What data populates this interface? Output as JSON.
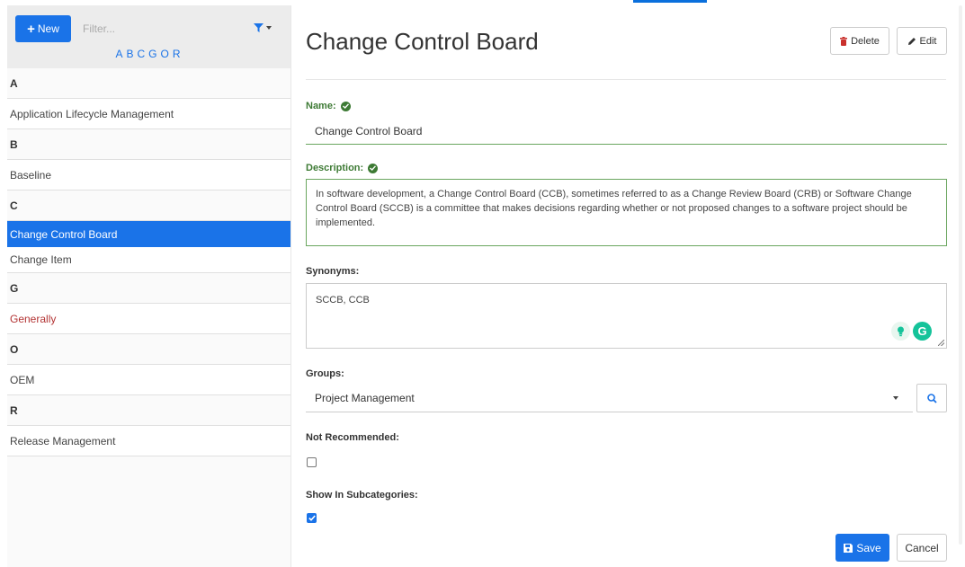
{
  "sidebar": {
    "new_label": "New",
    "filter_placeholder": "Filter...",
    "alpha_links": [
      "A",
      "B",
      "C",
      "G",
      "O",
      "R"
    ],
    "groups": [
      {
        "letter": "A",
        "items": [
          "Application Lifecycle Management"
        ]
      },
      {
        "letter": "B",
        "items": [
          "Baseline"
        ]
      },
      {
        "letter": "C",
        "items": [
          "Change Control Board",
          "Change Item"
        ]
      },
      {
        "letter": "G",
        "items": [
          "Generally"
        ]
      },
      {
        "letter": "O",
        "items": [
          "OEM"
        ]
      },
      {
        "letter": "R",
        "items": [
          "Release Management"
        ]
      }
    ],
    "selected_item": "Change Control Board"
  },
  "header": {
    "title": "Change Control Board",
    "delete_label": "Delete",
    "edit_label": "Edit"
  },
  "form": {
    "name_label": "Name:",
    "name_value": "Change Control Board",
    "description_label": "Description:",
    "description_value": "In software development, a Change Control Board (CCB), sometimes referred to as a Change Review Board (CRB) or Software Change Control Board (SCCB) is a committee that makes decisions regarding whether or not proposed changes to a software project should be implemented.",
    "synonyms_label": "Synonyms:",
    "synonyms_value": "SCCB, CCB",
    "groups_label": "Groups:",
    "groups_value": "Project Management",
    "not_recommended_label": "Not Recommended:",
    "not_recommended_checked": false,
    "show_in_subcategories_label": "Show In Subcategories:",
    "show_in_subcategories_checked": true,
    "save_label": "Save",
    "cancel_label": "Cancel"
  },
  "colors": {
    "accent": "#1a73e8",
    "valid_green": "#3d7a34",
    "warning_red": "#b33434"
  }
}
